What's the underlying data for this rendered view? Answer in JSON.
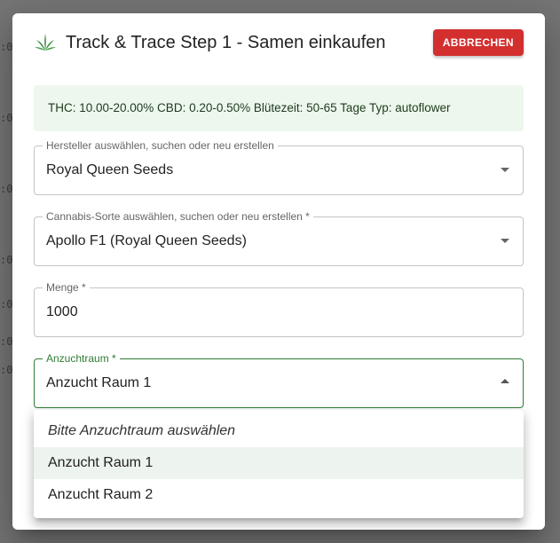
{
  "dialog": {
    "title": "Track & Trace Step 1 - Samen einkaufen",
    "cancel_label": "ABBRECHEN",
    "logo_icon": "cannabis-leaf-icon"
  },
  "info": {
    "text": "THC: 10.00-20.00%  CBD: 0.20-0.50%  Blütezeit: 50-65 Tage  Typ: autoflower"
  },
  "fields": {
    "manufacturer": {
      "label": "Hersteller auswählen, suchen oder neu erstellen",
      "value": "Royal Queen Seeds"
    },
    "strain": {
      "label": "Cannabis-Sorte auswählen, suchen oder neu erstellen *",
      "value": "Apollo F1 (Royal Queen Seeds)"
    },
    "quantity": {
      "label": "Menge *",
      "value": "1000"
    },
    "room": {
      "label": "Anzuchtraum *",
      "value": "Anzucht Raum 1"
    }
  },
  "menu": {
    "items": [
      {
        "label": "Bitte Anzuchtraum auswählen"
      },
      {
        "label": "Anzucht Raum 1"
      },
      {
        "label": "Anzucht Raum 2"
      }
    ]
  },
  "colors": {
    "accent": "#2e7d32",
    "danger": "#d32f2f",
    "info_bg": "#edf7ed"
  }
}
